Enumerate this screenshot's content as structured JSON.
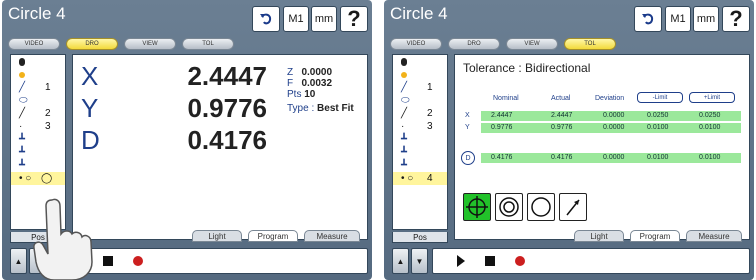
{
  "left": {
    "title": "Circle 4",
    "topbar": {
      "m1": "M1",
      "mm": "mm",
      "help": "?"
    },
    "tabs": [
      "VIDEO",
      "DRO",
      "VIEW",
      "TOL"
    ],
    "active_tab": "DRO",
    "sidebar_numbers": [
      "",
      "",
      "1",
      "",
      "2",
      "3",
      "",
      "",
      "",
      ""
    ],
    "pos_label": "Pos",
    "dro": [
      {
        "axis": "X",
        "value": "2.4447"
      },
      {
        "axis": "Y",
        "value": "0.9776"
      },
      {
        "axis": "D",
        "value": "0.4176"
      }
    ],
    "info": {
      "z_label": "Z",
      "z_value": "0.0000",
      "f_label": "F",
      "f_value": "0.0032",
      "pts_label": "Pts",
      "pts_value": "10",
      "type_label": "Type :",
      "type_value": "Best Fit"
    },
    "bottom_tabs": [
      "Light",
      "Program",
      "Measure"
    ],
    "active_bottom_tab": "Program"
  },
  "right": {
    "title": "Circle 4",
    "topbar": {
      "m1": "M1",
      "mm": "mm",
      "help": "?"
    },
    "tabs": [
      "VIDEO",
      "DRO",
      "VIEW",
      "TOL"
    ],
    "active_tab": "TOL",
    "sidebar_numbers": [
      "",
      "",
      "1",
      "",
      "2",
      "3",
      "",
      "",
      "",
      "4"
    ],
    "pos_label": "Pos",
    "tolerance_title": "Tolerance : Bidirectional",
    "headers": [
      "Nominal",
      "Actual",
      "Deviation",
      "-Limit",
      "+Limit"
    ],
    "rows": [
      {
        "axis": "X",
        "nominal": "2.4447",
        "actual": "2.4447",
        "deviation": "0.0000",
        "minus": "0.0250",
        "plus": "0.0250"
      },
      {
        "axis": "Y",
        "nominal": "0.9776",
        "actual": "0.9776",
        "deviation": "0.0000",
        "minus": "0.0100",
        "plus": "0.0100"
      },
      {
        "axis": "D",
        "nominal": "0.4176",
        "actual": "0.4176",
        "deviation": "0.0000",
        "minus": "0.0100",
        "plus": "0.0100"
      }
    ],
    "bottom_tabs": [
      "Light",
      "Program",
      "Measure"
    ],
    "active_bottom_tab": "Program"
  },
  "colors": {
    "accent_yellow": "#f2d93a",
    "tolerance_green": "#9be89b",
    "selected_tool": "#22c22a",
    "record": "#cc1f1f"
  }
}
